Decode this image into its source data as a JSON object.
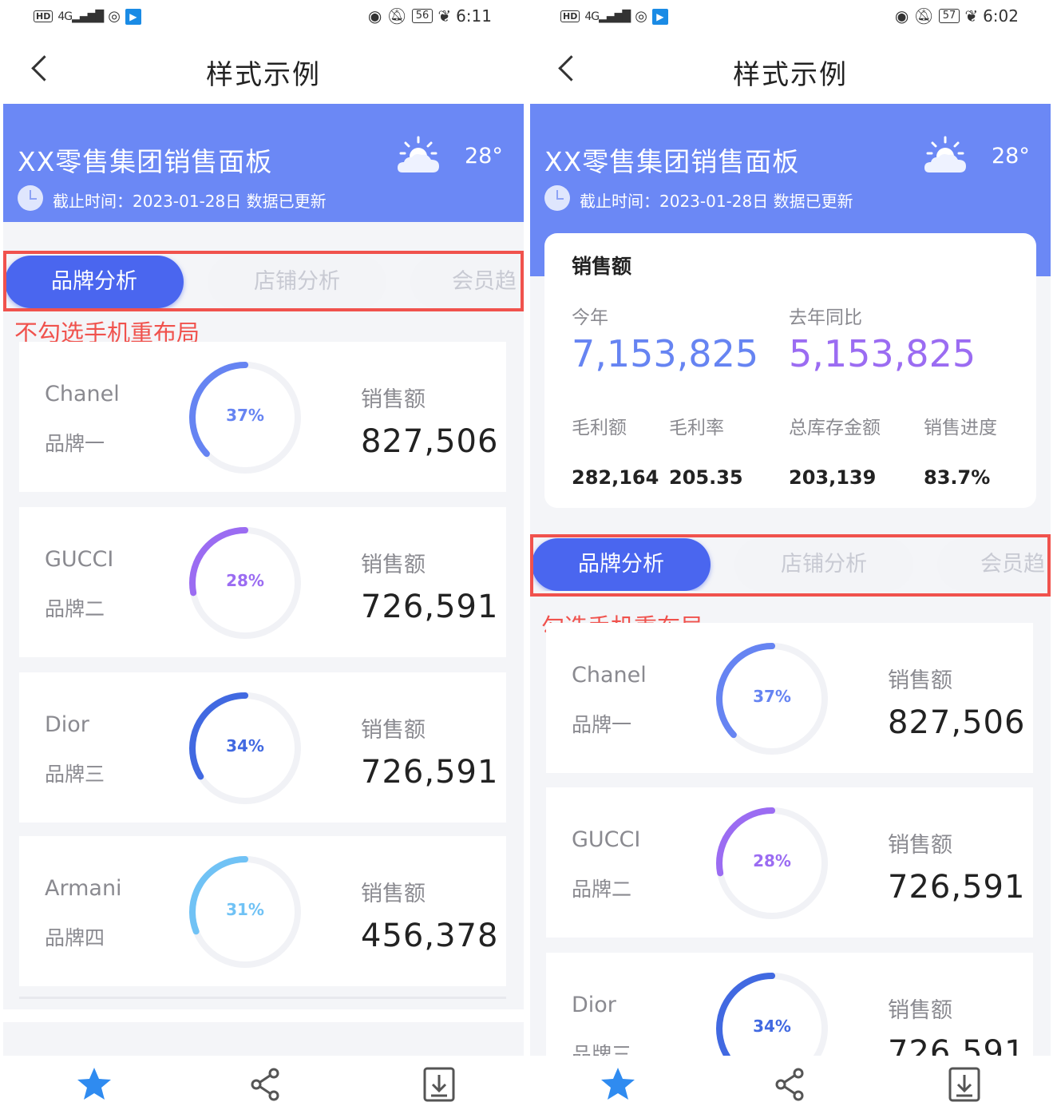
{
  "status_left": {
    "hd": "HD",
    "signal": "4G",
    "app_glyph": "▶"
  },
  "status_right_left": {
    "battery": "56",
    "time": "6:11"
  },
  "status_right_right": {
    "battery": "57",
    "time": "6:02"
  },
  "nav": {
    "title": "样式示例"
  },
  "hero": {
    "title": "XX零售集团销售面板",
    "temp": "28°",
    "subtitle": "截止时间：2023-01-28日  数据已更新"
  },
  "tabs": [
    "品牌分析",
    "店铺分析",
    "会员趋"
  ],
  "annotations": {
    "left": "不勾选手机重布局",
    "right": "勾选手机重布局"
  },
  "sales_label": "销售额",
  "brands": [
    {
      "name": "Chanel",
      "label": "品牌一",
      "pct": "37%",
      "pct_value": 0.37,
      "value": "827,506",
      "color": "#6684f2"
    },
    {
      "name": "GUCCI",
      "label": "品牌二",
      "pct": "28%",
      "pct_value": 0.28,
      "value": "726,591",
      "color": "#9b6cf2"
    },
    {
      "name": "Dior",
      "label": "品牌三",
      "pct": "34%",
      "pct_value": 0.34,
      "value": "726,591",
      "color": "#4169e1"
    },
    {
      "name": "Armani",
      "label": "品牌四",
      "pct": "31%",
      "pct_value": 0.31,
      "value": "456,378",
      "color": "#70c2f5"
    }
  ],
  "kpi": {
    "title": "销售额",
    "this_year_label": "今年",
    "this_year_value": "7,153,825",
    "last_year_label": "去年同比",
    "last_year_value": "5,153,825",
    "metrics": [
      {
        "label": "毛利额",
        "value": "282,164"
      },
      {
        "label": "毛利率",
        "value": "205.35"
      },
      {
        "label": "总库存金额",
        "value": "203,139"
      },
      {
        "label": "销售进度",
        "value": "83.7%"
      }
    ],
    "this_year_color": "#6684f2",
    "last_year_color": "#9b6cf2"
  }
}
